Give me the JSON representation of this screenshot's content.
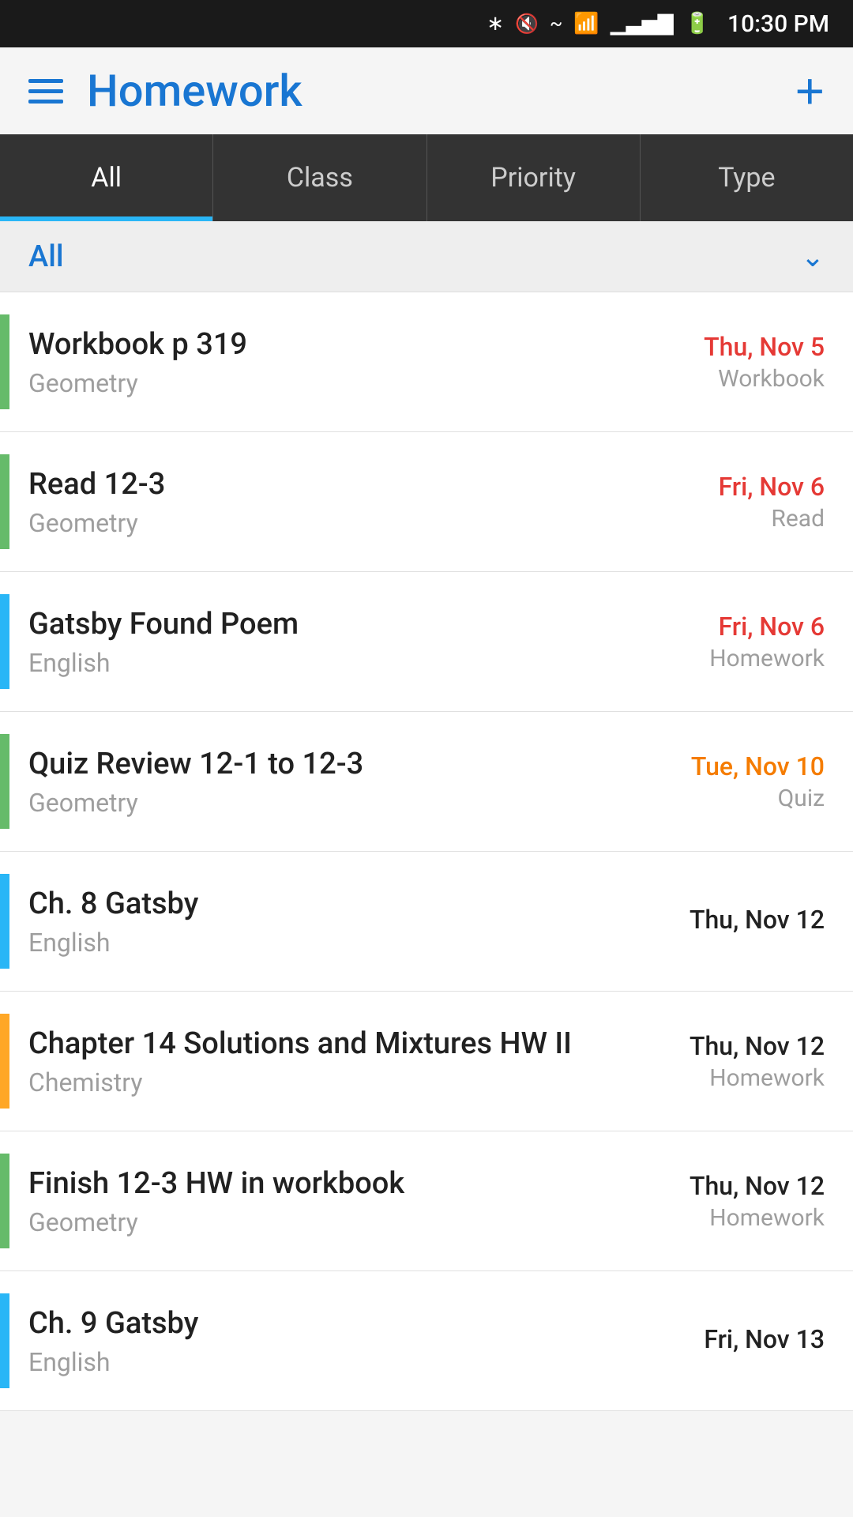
{
  "statusBar": {
    "time": "10:30 PM"
  },
  "header": {
    "title": "Homework",
    "addButton": "+"
  },
  "tabs": [
    {
      "label": "All",
      "active": true
    },
    {
      "label": "Class",
      "active": false
    },
    {
      "label": "Priority",
      "active": false
    },
    {
      "label": "Type",
      "active": false
    }
  ],
  "sectionHeader": {
    "title": "All",
    "chevron": "⌃"
  },
  "homeworkItems": [
    {
      "title": "Workbook p 319",
      "subtitle": "Geometry",
      "date": "Thu, Nov 5",
      "dateColor": "date-red",
      "type": "Workbook",
      "colorBar": "color-green"
    },
    {
      "title": "Read 12-3",
      "subtitle": "Geometry",
      "date": "Fri, Nov 6",
      "dateColor": "date-red",
      "type": "Read",
      "colorBar": "color-green"
    },
    {
      "title": "Gatsby Found Poem",
      "subtitle": "English",
      "date": "Fri, Nov 6",
      "dateColor": "date-red",
      "type": "Homework",
      "colorBar": "color-blue"
    },
    {
      "title": "Quiz Review 12-1 to 12-3",
      "subtitle": "Geometry",
      "date": "Tue, Nov 10",
      "dateColor": "date-orange",
      "type": "Quiz",
      "colorBar": "color-green"
    },
    {
      "title": "Ch. 8 Gatsby",
      "subtitle": "English",
      "date": "Thu, Nov 12",
      "dateColor": "date-black",
      "type": "",
      "colorBar": "color-blue"
    },
    {
      "title": "Chapter 14 Solutions and Mixtures HW II",
      "subtitle": "Chemistry",
      "date": "Thu, Nov 12",
      "dateColor": "date-black",
      "type": "Homework",
      "colorBar": "color-orange"
    },
    {
      "title": "Finish 12-3 HW in workbook",
      "subtitle": "Geometry",
      "date": "Thu, Nov 12",
      "dateColor": "date-black",
      "type": "Homework",
      "colorBar": "color-green"
    },
    {
      "title": "Ch. 9 Gatsby",
      "subtitle": "English",
      "date": "Fri, Nov 13",
      "dateColor": "date-black",
      "type": "",
      "colorBar": "color-blue"
    }
  ]
}
